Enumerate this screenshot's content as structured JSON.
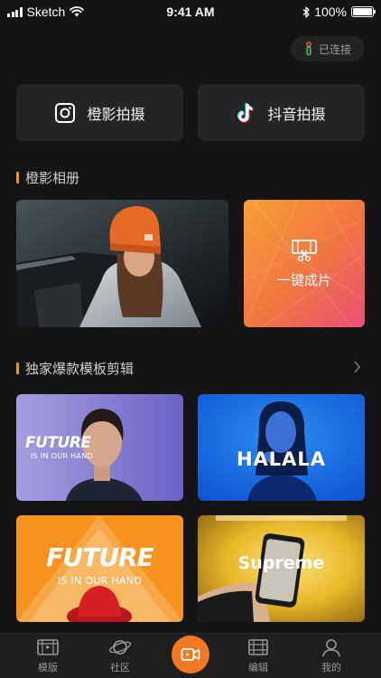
{
  "status_bar": {
    "carrier": "Sketch",
    "time": "9:41 AM",
    "battery": "100%",
    "signal_bars": 4
  },
  "header": {
    "connection_status": "已连接"
  },
  "actions": {
    "chengying_shoot": "橙影拍摄",
    "douyin_shoot": "抖音拍摄"
  },
  "album": {
    "title": "橙影相册",
    "one_click_label": "一键成片"
  },
  "templates": {
    "title": "独家爆款模板剪辑",
    "items": [
      {
        "title": "FUTURE",
        "subtitle": "IS IN OUR HAND"
      },
      {
        "title": "HALALA"
      },
      {
        "title": "FUTURE",
        "subtitle": "IS IN OUR HAND"
      },
      {
        "title": "Supreme"
      }
    ]
  },
  "tabbar": {
    "tabs": [
      {
        "label": "模版",
        "icon": "template-icon"
      },
      {
        "label": "社区",
        "icon": "planet-icon"
      },
      {
        "label": "",
        "icon": "camera-icon"
      },
      {
        "label": "编辑",
        "icon": "film-edit-icon"
      },
      {
        "label": "我的",
        "icon": "user-icon"
      }
    ]
  },
  "colors": {
    "accent": "#f07a22",
    "background": "#141414",
    "card": "#252525"
  }
}
